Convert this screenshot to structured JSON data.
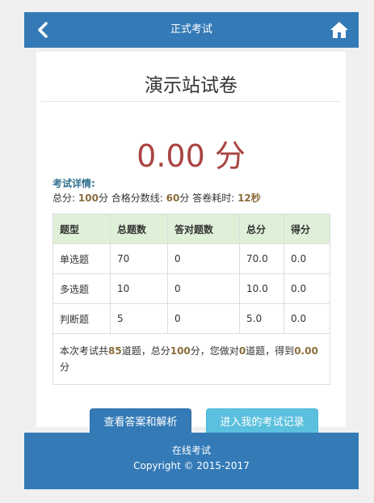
{
  "header": {
    "title": "正式考试",
    "back_icon": "chevron-left-icon",
    "home_icon": "home-icon"
  },
  "paper": {
    "title": "演示站试卷",
    "score": "0.00 分"
  },
  "details": {
    "label": "考试详情:",
    "total_label": "总分:",
    "total_value": "100",
    "total_unit": "分",
    "pass_label": "合格分数线:",
    "pass_value": "60",
    "pass_unit": "分",
    "time_label": "答卷耗时:",
    "time_value": "12秒"
  },
  "table": {
    "headers": [
      "题型",
      "总题数",
      "答对题数",
      "总分",
      "得分"
    ],
    "rows": [
      [
        "单选题",
        "70",
        "0",
        "70.0",
        "0.0"
      ],
      [
        "多选题",
        "10",
        "0",
        "10.0",
        "0.0"
      ],
      [
        "判断题",
        "5",
        "0",
        "5.0",
        "0.0"
      ]
    ],
    "summary": {
      "p1": "本次考试共",
      "total_questions": "85",
      "p2": "道题，总分",
      "total_score": "100",
      "p3": "分，您做对",
      "correct": "0",
      "p4": "道题，得到",
      "earned": "0.00",
      "p5": "分"
    }
  },
  "buttons": {
    "view_answers": "查看答案和解析",
    "my_records": "进入我的考试记录"
  },
  "footer": {
    "line1": "在线考试",
    "line2": "Copyright © 2015-2017"
  },
  "colors": {
    "primary": "#337ab7",
    "info": "#5bc0de",
    "danger": "#a94442",
    "success_bg": "#dff0d8",
    "warning_text": "#8a6d3b"
  }
}
